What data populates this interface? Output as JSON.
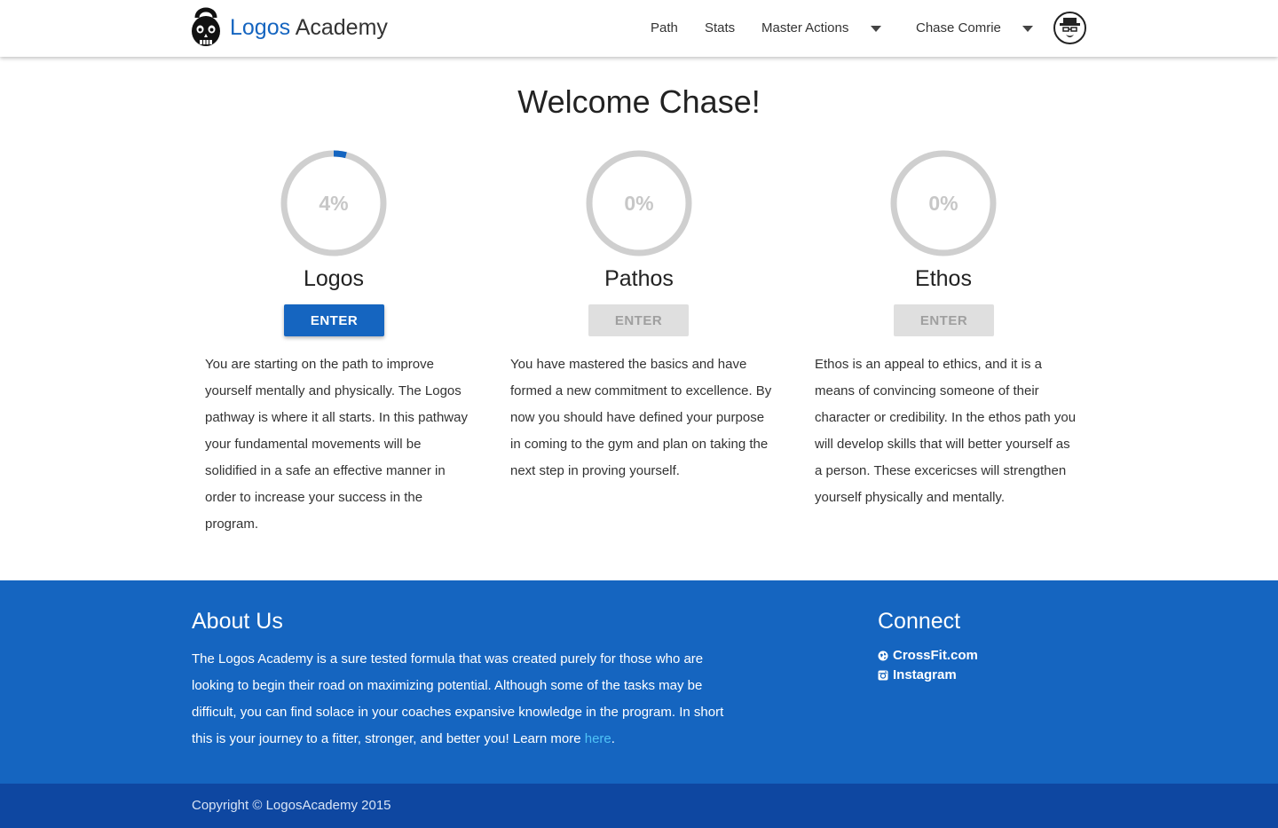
{
  "brand": {
    "part1": "Logos",
    "part2": "Academy"
  },
  "nav": {
    "path": "Path",
    "stats": "Stats",
    "master_actions": "Master Actions",
    "user_name": "Chase Comrie"
  },
  "welcome": "Welcome Chase!",
  "paths": [
    {
      "progress_label": "4%",
      "progress": 0.04,
      "title": "Logos",
      "button": "ENTER",
      "enabled": true,
      "description": "You are starting on the path to improve yourself mentally and physically. The Logos pathway is where it all starts. In this pathway your fundamental movements will be solidified in a safe an effective manner in order to increase your success in the program."
    },
    {
      "progress_label": "0%",
      "progress": 0,
      "title": "Pathos",
      "button": "ENTER",
      "enabled": false,
      "description": "You have mastered the basics and have formed a new commitment to excellence. By now you should have defined your purpose in coming to the gym and plan on taking the next step in proving yourself."
    },
    {
      "progress_label": "0%",
      "progress": 0,
      "title": "Ethos",
      "button": "ENTER",
      "enabled": false,
      "description": "Ethos is an appeal to ethics, and it is a means of convincing someone of their character or credibility. In the ethos path you will develop skills that will better yourself as a person. These excericses will strengthen yourself physically and mentally."
    }
  ],
  "footer": {
    "about_title": "About Us",
    "about_text": "The Logos Academy is a sure tested formula that was created purely for those who are looking to begin their road on maximizing potential. Although some of the tasks may be difficult, you can find solace in your coaches expansive knowledge in the program. In short this is your journey to a fitter, stronger, and better you! Learn more ",
    "about_link": "here",
    "about_end": ".",
    "connect_title": "Connect",
    "links": [
      "CrossFit.com",
      "Instagram"
    ],
    "copyright": "Copyright © LogosAcademy 2015"
  },
  "colors": {
    "primary": "#1565c0",
    "primary_dark": "#0e47a1",
    "ring_track": "#cfcfcf",
    "disabled_button": "#dfdfdf",
    "link": "#4fc3f7"
  },
  "icons": {
    "logo": "kettlebell-skull-icon",
    "avatar": "heisenberg-avatar-icon",
    "caret": "caret-down-icon",
    "crossfit": "globe-icon",
    "instagram": "instagram-icon"
  }
}
